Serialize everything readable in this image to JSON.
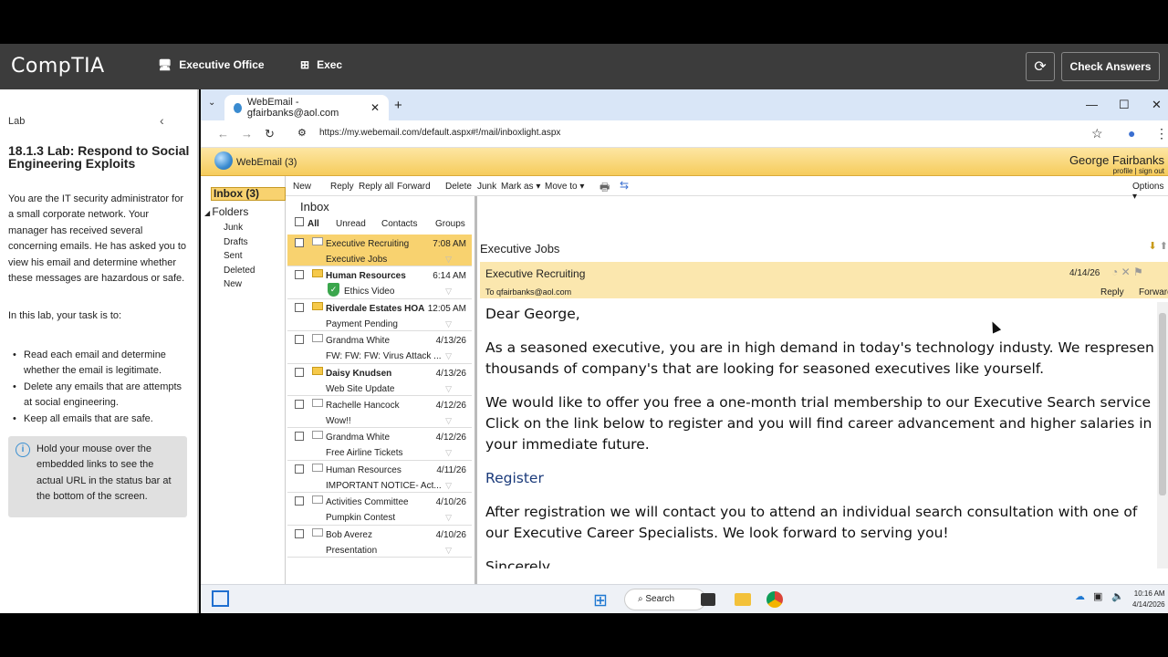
{
  "top": {
    "logo": "CompTIA",
    "crumb1": "Executive Office",
    "crumb2": "Exec",
    "check_answers": "Check Answers"
  },
  "lab": {
    "section": "Lab",
    "title": "18.1.3 Lab: Respond to Social Engineering Exploits",
    "intro": "You are the IT security administrator for a small corporate network. Your manager has received several concerning emails. He has asked you to view his email and determine whether these messages are hazardous or safe.",
    "task": "In this lab, your task is to:",
    "tasks": [
      "Read each email and determine whether the email is legitimate.",
      "Delete any emails that are attempts at social engineering.",
      "Keep all emails that are safe."
    ],
    "tip": "Hold your mouse over the embedded links to see the actual URL in the status bar at the bottom of the screen."
  },
  "browser": {
    "tab_title": "WebEmail - gfairbanks@aol.com",
    "url": "https://my.webemail.com/default.aspx#!/mail/inboxlight.aspx"
  },
  "owa": {
    "app_title": "WebEmail (3)",
    "user_name": "George Fairbanks",
    "user_links": "profile | sign out",
    "inbox_label": "Inbox (3)",
    "folders_label": "Folders",
    "folders": [
      "Junk",
      "Drafts",
      "Sent",
      "Deleted",
      "New"
    ],
    "toolbar": {
      "new": "New",
      "reply": "Reply",
      "reply_all": "Reply all",
      "forward": "Forward",
      "delete": "Delete",
      "junk": "Junk",
      "mark_as": "Mark as ▾",
      "move_to": "Move to ▾",
      "options": "Options ▾"
    },
    "list_title": "Inbox",
    "filters": {
      "all": "All",
      "unread": "Unread",
      "contacts": "Contacts",
      "groups": "Groups"
    },
    "messages": [
      {
        "from": "Executive Recruiting",
        "date": "7:08 AM",
        "subject": "Executive Jobs",
        "unread": false,
        "selected": true
      },
      {
        "from": "Human Resources",
        "date": "6:14 AM",
        "subject": "Ethics Video",
        "unread": true,
        "selected": false
      },
      {
        "from": "Riverdale Estates HOA",
        "date": "12:05 AM",
        "subject": "Payment Pending",
        "unread": true,
        "selected": false
      },
      {
        "from": "Grandma White",
        "date": "4/13/26",
        "subject": "FW: FW: FW: Virus Attack ...",
        "unread": false,
        "selected": false
      },
      {
        "from": "Daisy Knudsen",
        "date": "4/13/26",
        "subject": "Web Site Update",
        "unread": true,
        "selected": false
      },
      {
        "from": "Rachelle Hancock",
        "date": "4/12/26",
        "subject": "Wow!!",
        "unread": false,
        "selected": false
      },
      {
        "from": "Grandma White",
        "date": "4/12/26",
        "subject": "Free Airline Tickets",
        "unread": false,
        "selected": false
      },
      {
        "from": "Human Resources",
        "date": "4/11/26",
        "subject": "IMPORTANT NOTICE- Act...",
        "unread": false,
        "selected": false
      },
      {
        "from": "Activities Committee",
        "date": "4/10/26",
        "subject": "Pumpkin Contest",
        "unread": false,
        "selected": false
      },
      {
        "from": "Bob Averez",
        "date": "4/10/26",
        "subject": "Presentation",
        "unread": false,
        "selected": false
      }
    ],
    "reader": {
      "subject": "Executive Jobs",
      "from": "Executive Recruiting",
      "date": "4/14/26",
      "to": "To qfairbanks@aol.com",
      "reply": "Reply",
      "forward": "Forward",
      "greeting": "Dear George,",
      "p1a": "As a seasoned executive, you are in high demand in today's technology industy. We respresen",
      "p1b": "thousands of company's that are looking for seasoned executives like yourself.",
      "p2a": "We would like to offer you free a one-month trial membership to our Executive Search service",
      "p2b": "Click on the link below to register and you will find career advancement and higher salaries in",
      "p2c": "your immediate future.",
      "link": "Register",
      "p3a": "After registration we will contact you to attend an individual search consultation with one of",
      "p3b": "our Executive Career Specialists. We look forward to serving you!",
      "closing": "Sincerely"
    }
  },
  "taskbar": {
    "search": "Search",
    "time": "10:16 AM",
    "date": "4/14/2026"
  }
}
